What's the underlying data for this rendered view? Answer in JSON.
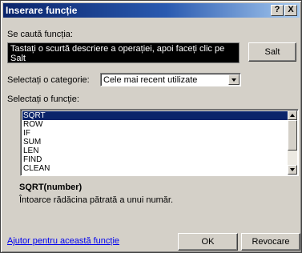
{
  "window": {
    "title": "Inserare funcție",
    "help_button": "?",
    "close_button": "X"
  },
  "search": {
    "label": "Se caută funcția:",
    "value": "Tastați o scurtă descriere a operației, apoi faceți clic pe Salt",
    "go_button": "Salt"
  },
  "category": {
    "label": "Selectați o categorie:",
    "selected": "Cele mai recent utilizate"
  },
  "functions": {
    "label": "Selectați o funcție:",
    "items": [
      "SQRT",
      "ROW",
      "IF",
      "SUM",
      "LEN",
      "FIND",
      "CLEAN"
    ],
    "selected_index": 0
  },
  "details": {
    "signature": "SQRT(number)",
    "description": "Întoarce rădăcina pătrată a unui număr."
  },
  "footer": {
    "help_link": "Ajutor pentru această funcție",
    "ok_button": "OK",
    "cancel_button": "Revocare"
  },
  "colors": {
    "title_bar": "#0a246a",
    "selection": "#0a246a",
    "dialog_face": "#d4d0c8",
    "link": "#0000ee"
  }
}
